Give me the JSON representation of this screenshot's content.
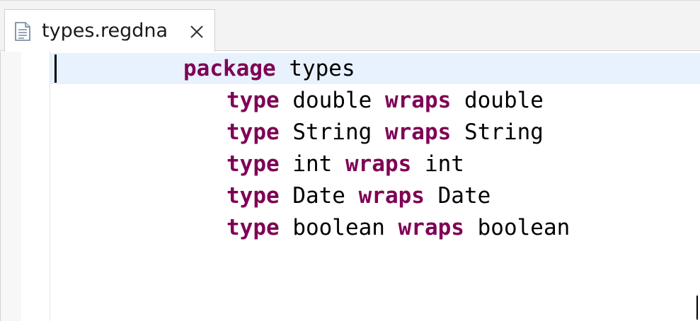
{
  "tab": {
    "label": "types.regdna",
    "icon": "text-file-icon",
    "close_icon": "close-icon"
  },
  "colors": {
    "keyword": "#7f0055",
    "current_line": "#e8f2fe",
    "tab_bar": "#f3f3f3"
  },
  "code": {
    "lines": [
      {
        "indent": 0,
        "tokens": [
          {
            "text": "package",
            "kw": true
          },
          {
            "text": " types",
            "kw": false
          }
        ]
      },
      {
        "indent": 1,
        "tokens": [
          {
            "text": "type",
            "kw": true
          },
          {
            "text": " double ",
            "kw": false
          },
          {
            "text": "wraps",
            "kw": true
          },
          {
            "text": " double",
            "kw": false
          }
        ]
      },
      {
        "indent": 1,
        "tokens": [
          {
            "text": "type",
            "kw": true
          },
          {
            "text": " String ",
            "kw": false
          },
          {
            "text": "wraps",
            "kw": true
          },
          {
            "text": " String",
            "kw": false
          }
        ]
      },
      {
        "indent": 1,
        "tokens": [
          {
            "text": "type",
            "kw": true
          },
          {
            "text": " int ",
            "kw": false
          },
          {
            "text": "wraps",
            "kw": true
          },
          {
            "text": " int",
            "kw": false
          }
        ]
      },
      {
        "indent": 1,
        "tokens": [
          {
            "text": "type",
            "kw": true
          },
          {
            "text": " Date ",
            "kw": false
          },
          {
            "text": "wraps",
            "kw": true
          },
          {
            "text": " Date",
            "kw": false
          }
        ]
      },
      {
        "indent": 1,
        "tokens": [
          {
            "text": "type",
            "kw": true
          },
          {
            "text": " boolean ",
            "kw": false
          },
          {
            "text": "wraps",
            "kw": true
          },
          {
            "text": " boolean",
            "kw": false
          }
        ]
      }
    ]
  }
}
